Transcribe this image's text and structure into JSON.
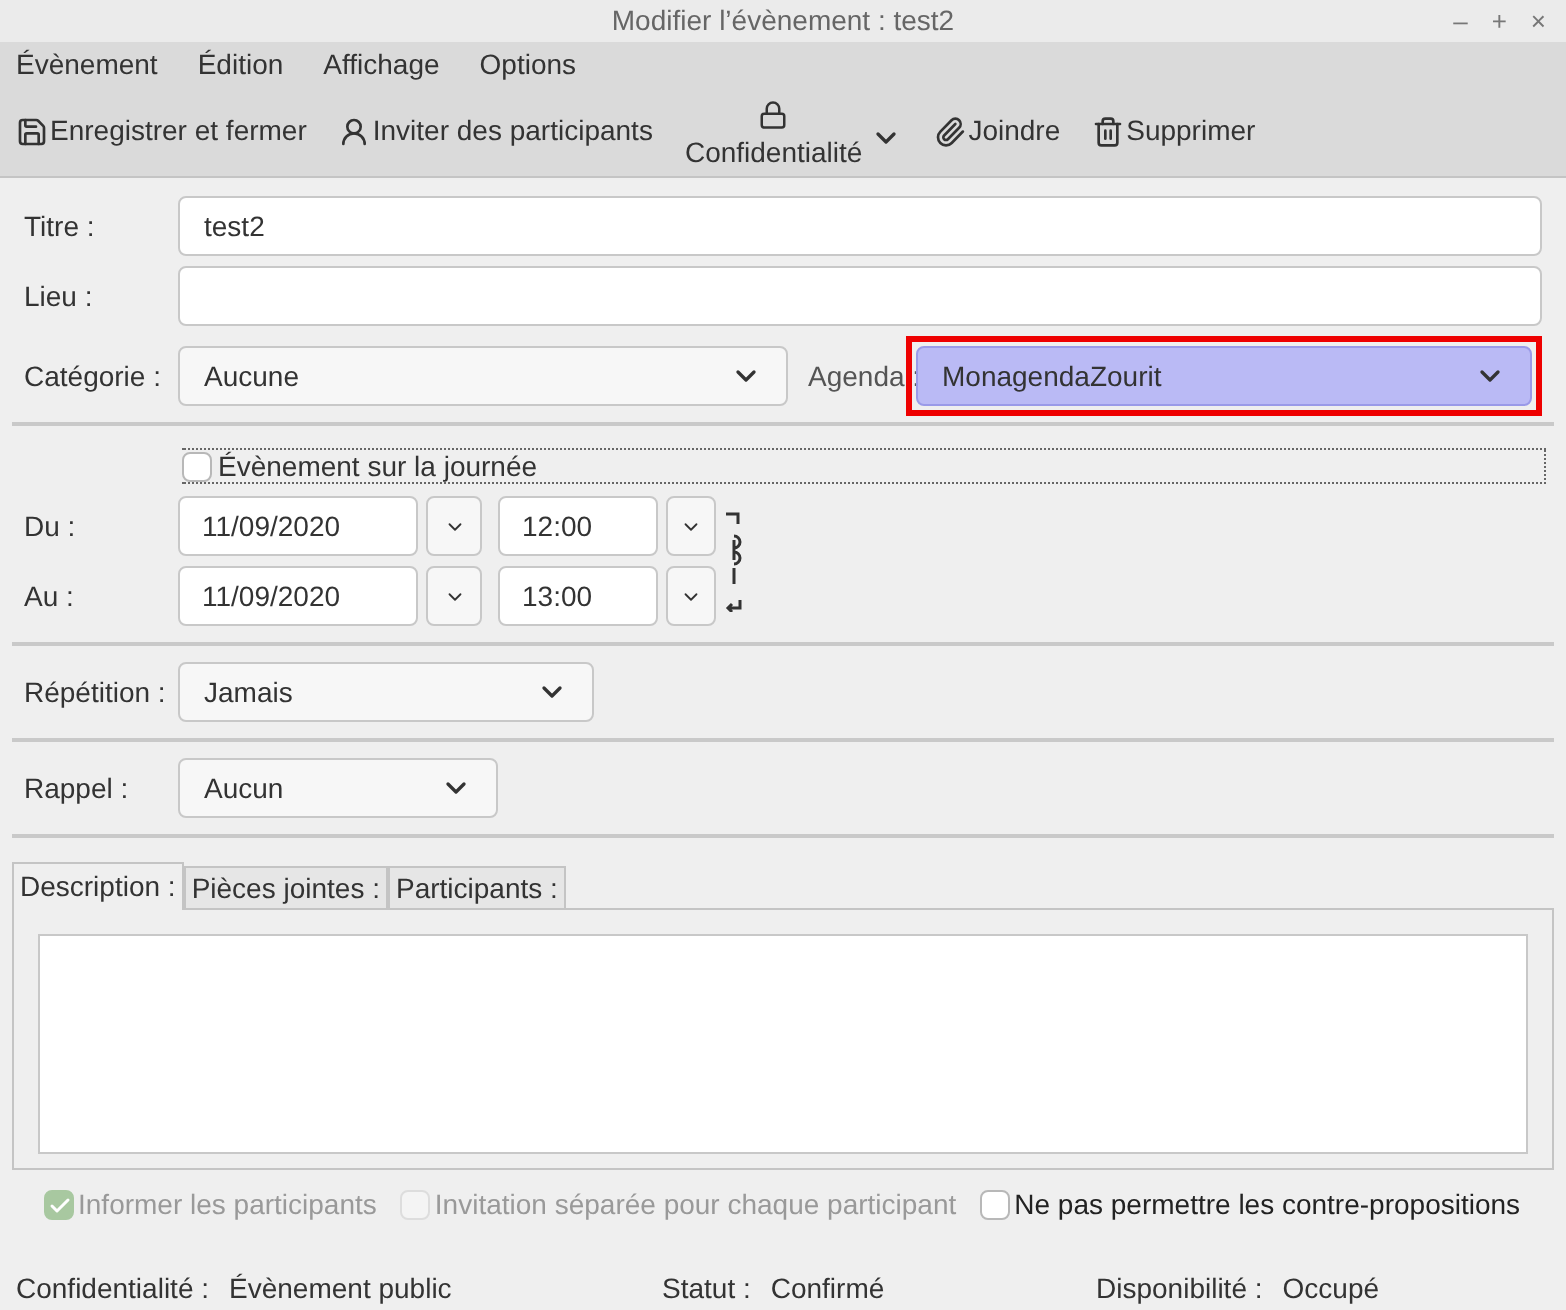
{
  "window": {
    "title": "Modifier l’évènement : test2",
    "controls": [
      "–",
      "+",
      "×"
    ]
  },
  "menu": [
    "Évènement",
    "Édition",
    "Affichage",
    "Options"
  ],
  "toolbar": [
    {
      "kind": "save",
      "label": "Enregistrer et fermer"
    },
    {
      "kind": "invite",
      "label": "Inviter des participants"
    },
    {
      "kind": "privacy",
      "label": "Confidentialité"
    },
    {
      "kind": "attach",
      "label": "Joindre"
    },
    {
      "kind": "delete",
      "label": "Supprimer"
    }
  ],
  "title_field": {
    "label": "Titre :",
    "value": "test2"
  },
  "location_field": {
    "label": "Lieu :"
  },
  "category": {
    "label": "Catégorie :",
    "value": "Aucune"
  },
  "calendar": {
    "label": "Agenda :",
    "value": "MonagendaZourit",
    "highlighted": true
  },
  "all_day": {
    "label": "Évènement sur la journée",
    "checked": false
  },
  "start": {
    "label": "Du :",
    "date": "11/09/2020",
    "time": "12:00"
  },
  "end": {
    "label": "Au :",
    "date": "11/09/2020",
    "time": "13:00"
  },
  "repeat": {
    "label": "Répétition :",
    "value": "Jamais"
  },
  "reminder": {
    "label": "Rappel :",
    "value": "Aucun"
  },
  "tabs": [
    {
      "label": "Description :",
      "selected": true
    },
    {
      "label": "Pièces jointes :",
      "selected": false
    },
    {
      "label": "Participants :",
      "selected": false
    }
  ],
  "options": [
    {
      "label": "Informer les participants",
      "checked": true,
      "disabled": true
    },
    {
      "label": "Invitation séparée pour chaque participant",
      "checked": false,
      "disabled": true
    },
    {
      "label": "Ne pas permettre les contre-propositions",
      "checked": false,
      "disabled": false
    }
  ],
  "status_bar": [
    {
      "label": "Confidentialité :",
      "value": "Évènement public"
    },
    {
      "label": "Statut :",
      "value": "Confirmé"
    },
    {
      "label": "Disponibilité :",
      "value": "Occupé"
    }
  ]
}
